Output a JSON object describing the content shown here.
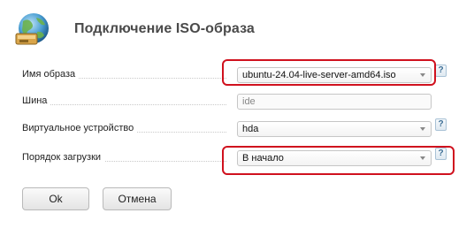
{
  "dialog": {
    "title": "Подключение ISO-образа",
    "icon": "globe-disk-icon"
  },
  "form": {
    "image_name": {
      "label": "Имя образа",
      "value": "ubuntu-24.04-live-server-amd64.iso"
    },
    "bus": {
      "label": "Шина",
      "value": "ide"
    },
    "virtual_device": {
      "label": "Виртуальное устройство",
      "value": "hda"
    },
    "boot_order": {
      "label": "Порядок загрузки",
      "value": "В начало"
    },
    "help_symbol": "?"
  },
  "buttons": {
    "ok": "Ok",
    "cancel": "Отмена"
  },
  "colors": {
    "highlight": "#d0111e",
    "title": "#4a4a4a",
    "help": "#3e6f96"
  }
}
